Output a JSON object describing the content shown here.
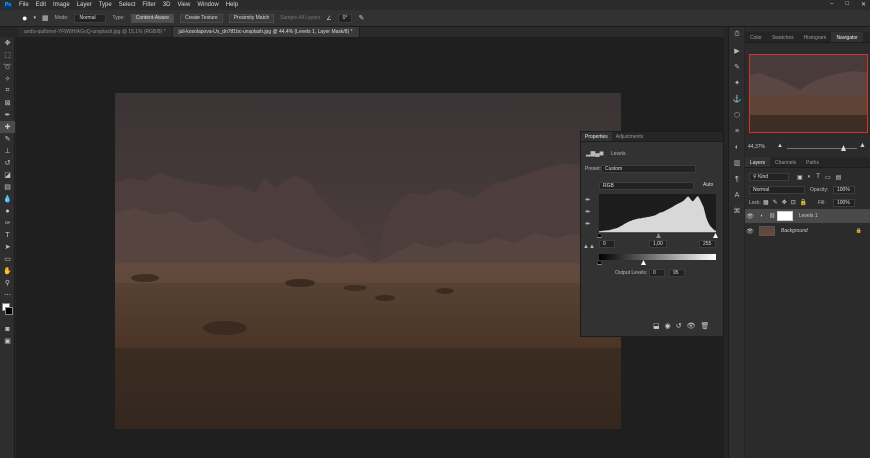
{
  "menubar": {
    "logo": "Ps",
    "items": [
      "File",
      "Edit",
      "Image",
      "Layer",
      "Type",
      "Select",
      "Filter",
      "3D",
      "View",
      "Window",
      "Help"
    ],
    "window_controls": [
      "–",
      "□",
      "✕"
    ]
  },
  "options": {
    "mode_label": "Mode:",
    "mode_value": "Normal",
    "type_label": "Type:",
    "content_aware": "Content-Aware",
    "create_texture": "Create Texture",
    "proximity_match": "Proximity Match",
    "sample_all_layers": "Sample All Layers",
    "angle_value": "0°"
  },
  "tabs": [
    "andis-quilbmel-YFW8HIAGoQ-unsplash.jpg @ 15,1% (RGB/8) *",
    "juli-kosolapova-Ux_dn7tf1bc-unsplash.jpg @ 44,4% (Levels 1, Layer Mask/8) *"
  ],
  "navigator": {
    "tabs": [
      "Color",
      "Swatches",
      "Histogram",
      "Navigator"
    ],
    "zoom": "44,37%"
  },
  "layers": {
    "tabs": [
      "Layers",
      "Channels",
      "Paths"
    ],
    "filter_label": "Kind",
    "blend_mode": "Normal",
    "opacity_label": "Opacity:",
    "opacity_value": "100%",
    "lock_label": "Lock:",
    "fill_label": "Fill:",
    "fill_value": "100%",
    "rows": [
      {
        "name": "Levels 1"
      },
      {
        "name": "Background"
      }
    ]
  },
  "properties": {
    "tabs": [
      "Properties",
      "Adjustments"
    ],
    "adjustment_title": "Levels",
    "preset_label": "Preset:",
    "preset_value": "Custom",
    "channel_value": "RGB",
    "input_black": "0",
    "input_gamma": "1,00",
    "input_white": "255",
    "output_label": "Output Levels:",
    "output_black": "0",
    "output_white": "95",
    "histogram_values": [
      2,
      2,
      3,
      3,
      4,
      4,
      5,
      5,
      6,
      7,
      8,
      9,
      10,
      11,
      13,
      15,
      17,
      19,
      22,
      24,
      26,
      28,
      30,
      31,
      33,
      34,
      35,
      36,
      37,
      38,
      38,
      39,
      40,
      40,
      41,
      42,
      42,
      43,
      44,
      45,
      46,
      48,
      50,
      52,
      54,
      55,
      56,
      58,
      60,
      62,
      64,
      66,
      68,
      70,
      73,
      75,
      77,
      79,
      81,
      83,
      85,
      88,
      92,
      96,
      99,
      95,
      90,
      85,
      87,
      92,
      97,
      100,
      94,
      86,
      78,
      70,
      55,
      40,
      30,
      22,
      16,
      12,
      8,
      5,
      3
    ]
  },
  "colors": {
    "accent": "#31a8ff",
    "selection_red": "#d0342c",
    "highlight": "#e8d64a"
  }
}
